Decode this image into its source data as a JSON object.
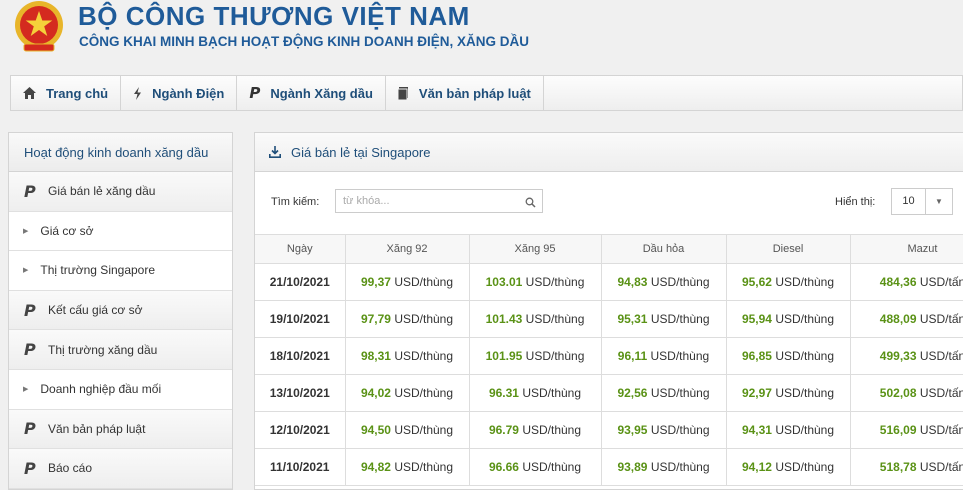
{
  "header": {
    "title": "BỘ CÔNG THƯƠNG VIỆT NAM",
    "subtitle": "CÔNG KHAI MINH BẠCH HOẠT ĐỘNG KINH DOANH ĐIỆN, XĂNG DẦU",
    "emblem_icon": "national-emblem-icon"
  },
  "nav": {
    "items": [
      {
        "label": "Trang chủ",
        "icon": "home-icon"
      },
      {
        "label": "Ngành Điện",
        "icon": "bolt-icon"
      },
      {
        "label": "Ngành Xăng dầu",
        "icon": "p-icon"
      },
      {
        "label": "Văn bản pháp luật",
        "icon": "book-icon"
      }
    ]
  },
  "sidebar": {
    "title": "Hoạt động kinh doanh xăng dầu",
    "items": [
      {
        "label": "Giá bán lẻ xăng dầu",
        "type": "category"
      },
      {
        "label": "Giá cơ sở",
        "type": "sub"
      },
      {
        "label": "Thị trường Singapore",
        "type": "sub"
      },
      {
        "label": "Kết cấu giá cơ sở",
        "type": "category"
      },
      {
        "label": "Thị trường xăng dầu",
        "type": "category"
      },
      {
        "label": "Doanh nghiệp đầu mối",
        "type": "sub"
      },
      {
        "label": "Văn bản pháp luật",
        "type": "category"
      },
      {
        "label": "Báo cáo",
        "type": "category"
      }
    ]
  },
  "panel": {
    "title": "Giá bán lẻ tại Singapore",
    "search_label": "Tìm kiếm:",
    "search_placeholder": "từ khóa...",
    "show_label": "Hiển thị:",
    "show_value": "10"
  },
  "table": {
    "columns": [
      "Ngày",
      "Xăng 92",
      "Xăng 95",
      "Dầu hỏa",
      "Diesel",
      "Mazut"
    ],
    "rows": [
      {
        "date": "21/10/2021",
        "cells": [
          {
            "v": "99,37",
            "u": "USD/thùng"
          },
          {
            "v": "103.01",
            "u": "USD/thùng"
          },
          {
            "v": "94,83",
            "u": "USD/thùng"
          },
          {
            "v": "95,62",
            "u": "USD/thùng"
          },
          {
            "v": "484,36",
            "u": "USD/tấn"
          }
        ]
      },
      {
        "date": "19/10/2021",
        "cells": [
          {
            "v": "97,79",
            "u": "USD/thùng"
          },
          {
            "v": "101.43",
            "u": "USD/thùng"
          },
          {
            "v": "95,31",
            "u": "USD/thùng"
          },
          {
            "v": "95,94",
            "u": "USD/thùng"
          },
          {
            "v": "488,09",
            "u": "USD/tấn"
          }
        ]
      },
      {
        "date": "18/10/2021",
        "cells": [
          {
            "v": "98,31",
            "u": "USD/thùng"
          },
          {
            "v": "101.95",
            "u": "USD/thùng"
          },
          {
            "v": "96,11",
            "u": "USD/thùng"
          },
          {
            "v": "96,85",
            "u": "USD/thùng"
          },
          {
            "v": "499,33",
            "u": "USD/tấn"
          }
        ]
      },
      {
        "date": "13/10/2021",
        "cells": [
          {
            "v": "94,02",
            "u": "USD/thùng"
          },
          {
            "v": "96.31",
            "u": "USD/thùng"
          },
          {
            "v": "92,56",
            "u": "USD/thùng"
          },
          {
            "v": "92,97",
            "u": "USD/thùng"
          },
          {
            "v": "502,08",
            "u": "USD/tấn"
          }
        ]
      },
      {
        "date": "12/10/2021",
        "cells": [
          {
            "v": "94,50",
            "u": "USD/thùng"
          },
          {
            "v": "96.79",
            "u": "USD/thùng"
          },
          {
            "v": "93,95",
            "u": "USD/thùng"
          },
          {
            "v": "94,31",
            "u": "USD/thùng"
          },
          {
            "v": "516,09",
            "u": "USD/tấn"
          }
        ]
      },
      {
        "date": "11/10/2021",
        "cells": [
          {
            "v": "94,82",
            "u": "USD/thùng"
          },
          {
            "v": "96.66",
            "u": "USD/thùng"
          },
          {
            "v": "93,89",
            "u": "USD/thùng"
          },
          {
            "v": "94,12",
            "u": "USD/thùng"
          },
          {
            "v": "518,78",
            "u": "USD/tấn"
          }
        ]
      }
    ]
  },
  "colors": {
    "brand_blue": "#1f5b99",
    "value_green": "#5a9216",
    "emblem_red": "#d42a1f",
    "emblem_gold": "#e8b52a"
  }
}
